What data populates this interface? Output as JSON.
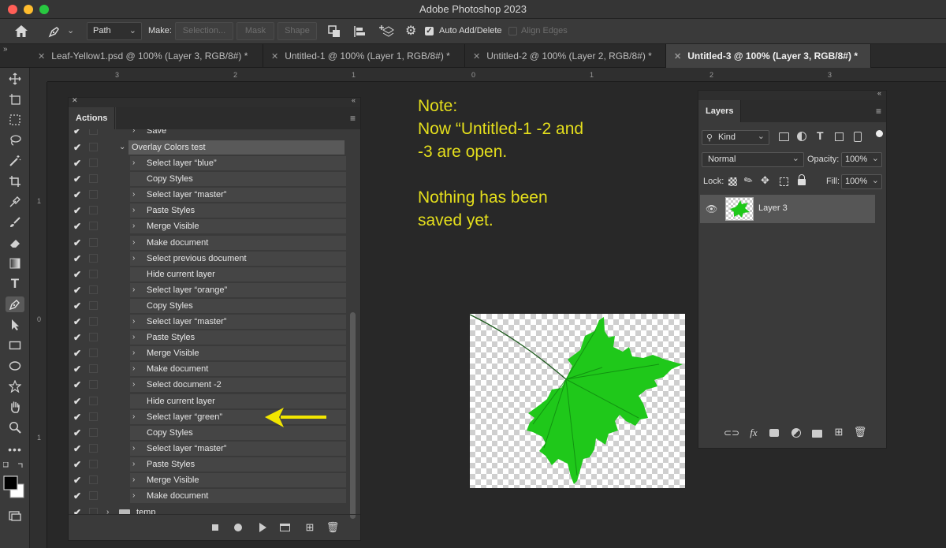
{
  "app": {
    "title": "Adobe Photoshop 2023"
  },
  "window": {
    "traffic_lights": [
      "#ff5f57",
      "#febc2e",
      "#28c840"
    ]
  },
  "options_bar": {
    "home_icon": "home-icon",
    "tool_icon": "pen-tool-icon",
    "mode_select": "Path",
    "make_label": "Make:",
    "selection_button": "Selection...",
    "mask_button": "Mask",
    "shape_button": "Shape",
    "gear_icon": "gear-icon",
    "auto_add_delete": {
      "label": "Auto Add/Delete",
      "checked": true
    },
    "align_edges": {
      "label": "Align Edges",
      "checked": false
    }
  },
  "tabs": [
    {
      "label": "Leaf-Yellow1.psd @ 100% (Layer 3, RGB/8#) *",
      "active": false
    },
    {
      "label": "Untitled-1 @ 100% (Layer 1, RGB/8#) *",
      "active": false
    },
    {
      "label": "Untitled-2 @ 100% (Layer 2, RGB/8#) *",
      "active": false
    },
    {
      "label": "Untitled-3 @ 100% (Layer 3, RGB/8#) *",
      "active": true
    }
  ],
  "ruler": {
    "h_labels": [
      "3",
      "2",
      "1",
      "0",
      "1",
      "2",
      "3"
    ],
    "v_labels": [
      "1",
      "0",
      "1"
    ]
  },
  "actions_panel": {
    "tab_label": "Actions",
    "top_partial": "Save",
    "set_name": "Overlay Colors test",
    "steps": [
      {
        "label": "Select layer “blue”",
        "expandable": true
      },
      {
        "label": "Copy Styles",
        "expandable": false
      },
      {
        "label": "Select layer “master”",
        "expandable": true
      },
      {
        "label": "Paste Styles",
        "expandable": true
      },
      {
        "label": "Merge Visible",
        "expandable": true
      },
      {
        "label": "Make document",
        "expandable": true
      },
      {
        "label": "Select previous document",
        "expandable": true
      },
      {
        "label": "Hide current layer",
        "expandable": false
      },
      {
        "label": "Select layer “orange”",
        "expandable": true
      },
      {
        "label": "Copy Styles",
        "expandable": false
      },
      {
        "label": "Select layer “master”",
        "expandable": true
      },
      {
        "label": "Paste Styles",
        "expandable": true
      },
      {
        "label": "Merge Visible",
        "expandable": true
      },
      {
        "label": "Make document",
        "expandable": true
      },
      {
        "label": "Select document -2",
        "expandable": true
      },
      {
        "label": "Hide current layer",
        "expandable": false
      },
      {
        "label": "Select layer “green”",
        "expandable": true
      },
      {
        "label": "Copy Styles",
        "expandable": false
      },
      {
        "label": "Select layer “master”",
        "expandable": true
      },
      {
        "label": "Paste Styles",
        "expandable": true
      },
      {
        "label": "Merge Visible",
        "expandable": true
      },
      {
        "label": "Make document",
        "expandable": true
      }
    ],
    "bottom_set": "temp",
    "footer_icons": [
      "stop-icon",
      "record-icon",
      "play-icon",
      "new-set-icon",
      "new-action-icon",
      "trash-icon"
    ]
  },
  "annotation": {
    "lines": [
      "Note:",
      "Now “Untitled-1 -2 and",
      "-3 are open.",
      "",
      "Nothing has been",
      "saved yet."
    ],
    "color": "#e5df1c",
    "arrow_color": "#f2e600"
  },
  "layers_panel": {
    "tab_label": "Layers",
    "filter_label": "Kind",
    "blend_mode": "Normal",
    "opacity_label": "Opacity:",
    "opacity_value": "100%",
    "lock_label": "Lock:",
    "fill_label": "Fill:",
    "fill_value": "100%",
    "layers": [
      {
        "name": "Layer 3",
        "visible": true
      }
    ],
    "footer_icons": [
      "link-icon",
      "fx-icon",
      "mask-icon",
      "adjustment-icon",
      "folder-icon",
      "new-layer-icon",
      "trash-icon"
    ]
  },
  "colors": {
    "leaf": "#22c41c",
    "leaf_dark": "#0f8a0f"
  }
}
